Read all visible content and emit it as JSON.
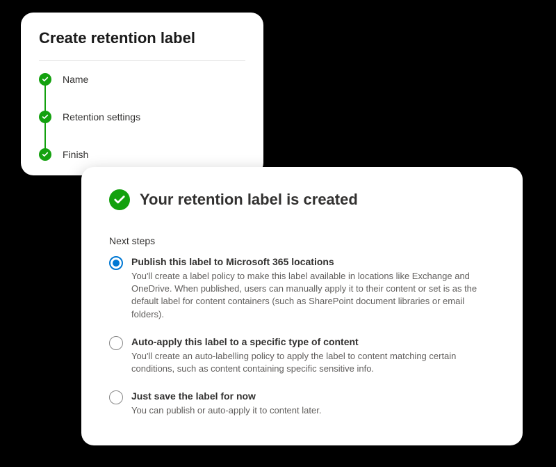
{
  "wizard": {
    "title": "Create retention label",
    "steps": [
      {
        "label": "Name"
      },
      {
        "label": "Retention settings"
      },
      {
        "label": "Finish"
      }
    ]
  },
  "result": {
    "title": "Your retention label is created",
    "section_label": "Next steps",
    "options": [
      {
        "title": "Publish this label to Microsoft 365 locations",
        "desc": "You'll create a label policy to make this label available in locations like Exchange and OneDrive. When published, users can manually apply it to their content or set is as the default label for content containers (such as SharePoint document libraries or email folders).",
        "selected": true
      },
      {
        "title": "Auto-apply this label to a specific type of content",
        "desc": "You'll create an auto-labelling policy to apply the label to content matching certain conditions, such as content containing specific sensitive info.",
        "selected": false
      },
      {
        "title": "Just save the label for now",
        "desc": "You can publish or auto-apply it to content later.",
        "selected": false
      }
    ]
  }
}
